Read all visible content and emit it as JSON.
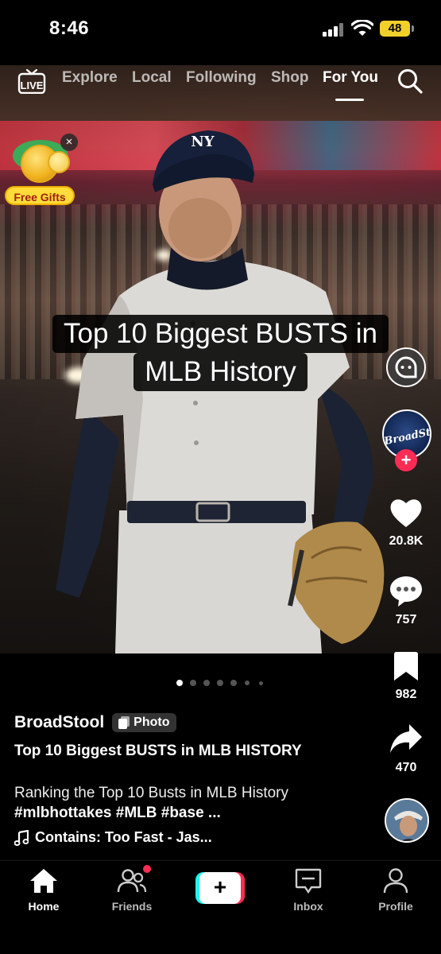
{
  "status_bar": {
    "time": "8:46",
    "battery": "48"
  },
  "top_nav": {
    "live_label": "LIVE",
    "tabs": [
      {
        "label": "Explore",
        "active": false
      },
      {
        "label": "Local",
        "active": false
      },
      {
        "label": "Following",
        "active": false
      },
      {
        "label": "Shop",
        "active": false
      },
      {
        "label": "For You",
        "active": true
      }
    ]
  },
  "gift_widget": {
    "label": "Free Gifts",
    "close": "×"
  },
  "overlay": {
    "line1": "Top 10 Biggest BUSTS in",
    "line2": "MLB History"
  },
  "rail": {
    "avatar_text": "BroadStool",
    "likes": "20.8K",
    "comments": "757",
    "saves": "982",
    "shares": "470"
  },
  "carousel": {
    "total": 7,
    "active": 0
  },
  "post": {
    "author": "BroadStool",
    "badge": "Photo",
    "title": "Top 10 Biggest BUSTS in MLB HISTORY",
    "desc_text": "Ranking the Top 10 Busts in MLB History ",
    "desc_tags": "#mlbhottakes #MLB #base ...",
    "music": "Contains: Too Fast - Jas..."
  },
  "bottom_nav": {
    "home": "Home",
    "friends": "Friends",
    "create": "+",
    "inbox": "Inbox",
    "profile": "Profile"
  },
  "colors": {
    "accent": "#fe2c55",
    "cyan": "#25f4ee",
    "badge_bg": "#333333"
  }
}
